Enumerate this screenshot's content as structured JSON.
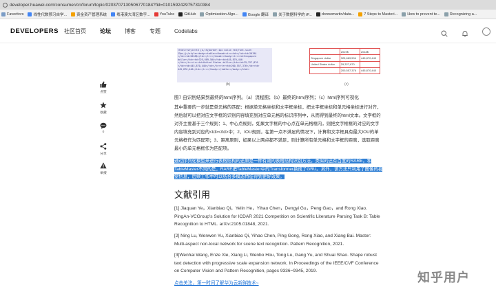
{
  "browser": {
    "url": "developer.huawei.com/consumer/cn/forum/topic/0203707130506770184?fid=0101592429757310384"
  },
  "bookmarks": [
    {
      "label": "Favoritors",
      "icon": "folder-icon",
      "color": "#7a9cc6"
    },
    {
      "label": "线性代数预习自学...",
      "icon": "bookmark-icon",
      "color": "#4285f4"
    },
    {
      "label": "资金资产管理系统",
      "icon": "bookmark-icon",
      "color": "#f4a100"
    },
    {
      "label": "粤港澳大湾区数字...",
      "icon": "bookmark-icon",
      "color": "#4285f4"
    },
    {
      "label": "YouTube",
      "icon": "youtube-icon",
      "color": "#e53935"
    },
    {
      "label": "GitHub",
      "icon": "github-icon",
      "color": "#222222"
    },
    {
      "label": "Optimization Algo...",
      "icon": "bookmark-icon",
      "color": "#8aa0aa"
    },
    {
      "label": "Google 翻译",
      "icon": "google-translate-icon",
      "color": "#4285f4"
    },
    {
      "label": "关于数据科学的 iP...",
      "icon": "bookmark-icon",
      "color": "#8aa0aa"
    },
    {
      "label": "donnemartin/data...",
      "icon": "github-icon",
      "color": "#222222"
    },
    {
      "label": "7 Steps to Masteri...",
      "icon": "bookmark-icon",
      "color": "#f4a100"
    },
    {
      "label": "How to prevent te...",
      "icon": "bookmark-icon",
      "color": "#8aa0aa"
    },
    {
      "label": "Recognizing a...",
      "icon": "bookmark-icon",
      "color": "#8aa0aa"
    }
  ],
  "header": {
    "logo": "DEVELOPERS",
    "nav": [
      "社区首页",
      "论坛",
      "博客",
      "专题",
      "Codelabs"
    ],
    "active_nav": "论坛"
  },
  "figure": {
    "code_lines": [
      "<html><style>td {a,th{border:1px solid red;font-size:",
      "15px;}</style><body><table><thead><tr><td></td><td>2019$",
      "</td><td>2018$</td></tr></thead><tbody><tr><td>Singapore",
      "dollar</td><td>325,689,504</td><td>445,870,440",
      "</td></tr><tr><td>United States dollar</td><td>29,327,870",
      "</td><td>445,870,440</td></tr><tr><td>200,557,376</td><td>",
      "445,870,440</td></tr></tbody></table></body></html>"
    ],
    "table": [
      [
        "",
        "2019$",
        "2018$"
      ],
      [
        "Singapore dollar",
        "325,689,504",
        "445,870,440"
      ],
      [
        "United States dollar",
        "29,327,870",
        ""
      ],
      [
        "",
        "200,557,376",
        "445,870,440"
      ]
    ],
    "caption_b": "(b)",
    "caption_c": "(c)"
  },
  "article": {
    "caption": "图7 由识别结果到最终的html序列。（a）流程图；（b）最终的html序列；（c）html序列可视化",
    "paragraph": "其中重要的一步就是单元格的匹配：根据单元格坐标和文字框坐标，把文字框坐标和单元格坐标进行对齐，然后就可以把对应文字框的识别内容填充到对应单元格的标识序列中，从而得到最终的html文本。文字框的对齐主要基于三个规则：1、中心点规则，如果文字框的中心点在单元格框内，则把文字框框的对应的文字内容填充到对应的<td></td>中；2、IOU规则，在第一点不满足的情况下，计算和文字框具有最大IOU的单元格框作为匹配项；3、距离原则，如果以上两点都不满足，则计算所有单元格和文字框的距离，选取距离最小的单元格框作为匹配项。",
    "highlight": "通过序列化模型来进行表格结构的还原是一种有效的表格结构识别方法，类似的还有百度的RARE，和TableMaster不同的是，RARE把TableMaster中的Transformer换成了GRU。另外，该方法只利用了图像的视觉信息，后续工作中可以结合多模态特征得到更好效果。",
    "refs_title": "文献引用",
    "refs": [
      "[1] Jiaquan Ye，Xianbiao Qi，Yelin He，Yihao Chen，Dengyi Gu，Peng Gao，and Rong Xiao. PingAn-VCGroup's Solution for ICDAR 2021 Competition on Scientific Literature Parsing Task B: Table Recognition to HTML. arXiv:2105.01848, 2021.",
      "[2] Ning Lu, Wenwen Yu, Xianbiao Qi, Yihao Chen, Ping Gong, Rong Xiao, and Xiang Bai. Master: Multi-aspect non-local network for scene text recognition. Pattern Recognition, 2021.",
      "[3]Wenhai Wang, Enze Xie, Xiang Li, Wenbo Hou, Tong Lu, Gang Yu, and Shuai Shao. Shape robust text detection with progressive scale expansion network. In Proceedings of the IEEE/CVF Conference on Computer Vision and Pattern Recognition, pages 9336−9345, 2019."
    ],
    "more_link": "点击关注，第一时间了解华为云新鲜技术~"
  },
  "sidebar": {
    "like": "点赞",
    "favorite": "收藏",
    "comment": "0",
    "share": "分享",
    "report": "举报"
  },
  "watermark": "知乎用户"
}
